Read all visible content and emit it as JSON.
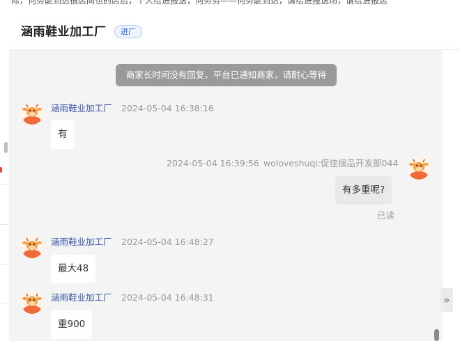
{
  "background_page": {
    "top_strip_text": "际，何务能到达宿店间也的店后，个人给进报送，何务务——何务能到达，请给进报送场，请给进报店"
  },
  "header": {
    "shop_name": "涵雨鞋业加工厂",
    "enter_shop_label": "进厂"
  },
  "notice": "商家长时间没有回复，平台已通知商家，请耐心等待",
  "messages": [
    {
      "side": "left",
      "sender": "涵雨鞋业加工厂",
      "time": "2024-05-04 16:38:16",
      "text": "有"
    },
    {
      "side": "right",
      "sender": "woloveshuqi:促佳搜品开发部044",
      "time": "2024-05-04 16:39:56",
      "text": "有多重呢?",
      "status": "已读"
    },
    {
      "side": "left",
      "sender": "涵雨鞋业加工厂",
      "time": "2024-05-04 16:48:27",
      "text": "最大48"
    },
    {
      "side": "left",
      "sender": "涵雨鞋业加工厂",
      "time": "2024-05-04 16:48:31",
      "text": "重900"
    }
  ],
  "collapse_icon": "double-chevron-right-icon",
  "avatar_icon": "cartoon-cow-icon",
  "colors": {
    "accent_blue": "#3a55a8",
    "notice_bg": "#9a9a9a",
    "chat_bg": "#f4f4f4",
    "avatar_orange": "#f06a3a"
  }
}
